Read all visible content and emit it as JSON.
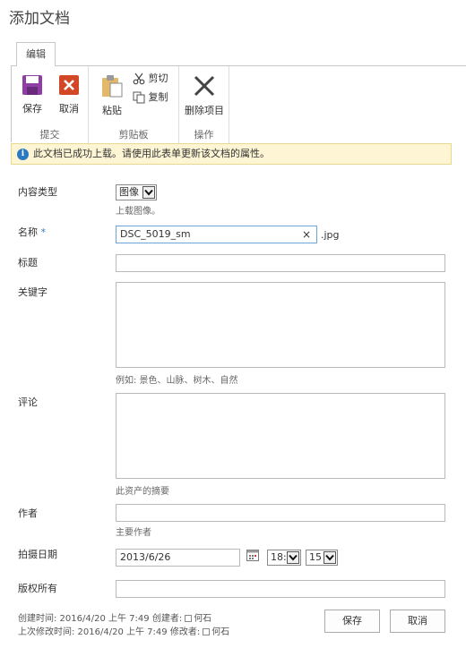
{
  "page_title": "添加文档",
  "ribbon": {
    "tab_label": "编辑",
    "groups": {
      "commit": {
        "label": "提交",
        "save": "保存",
        "cancel": "取消"
      },
      "clipboard": {
        "label": "剪贴板",
        "paste": "粘贴",
        "cut": "剪切",
        "copy": "复制"
      },
      "actions": {
        "label": "操作",
        "delete": "删除项目"
      }
    }
  },
  "notice": {
    "icon": "info-icon",
    "text": "此文档已成功上载。请使用此表单更新该文档的属性。"
  },
  "form": {
    "content_type": {
      "label": "内容类型",
      "value": "图像",
      "hint": "上载图像。"
    },
    "name": {
      "label": "名称",
      "required_mark": "*",
      "value": "DSC_5019_sm",
      "clear": "×",
      "suffix": ".jpg"
    },
    "title": {
      "label": "标题",
      "value": ""
    },
    "keywords": {
      "label": "关键字",
      "hint": "例如: 景色、山脉、树木、自然"
    },
    "comment": {
      "label": "评论",
      "hint": "此资产的摘要"
    },
    "author": {
      "label": "作者",
      "value": "",
      "hint": "主要作者"
    },
    "date_taken": {
      "label": "拍摄日期",
      "date": "2013/6/26",
      "hour": "18:",
      "minute": "15"
    },
    "copyright": {
      "label": "版权所有",
      "value": ""
    }
  },
  "footer": {
    "created_prefix": "创建时间: 2016/4/20 上午 7:49 创建者:",
    "created_by": "何石",
    "modified_prefix": "上次修改时间: 2016/4/20 上午 7:49 修改者:",
    "modified_by": "何石",
    "save": "保存",
    "cancel": "取消"
  },
  "colors": {
    "accent": "#2b79c2",
    "notice_bg": "#fdf5d3",
    "save_icon": "#8e3ea4",
    "cancel_icon": "#d24726"
  }
}
